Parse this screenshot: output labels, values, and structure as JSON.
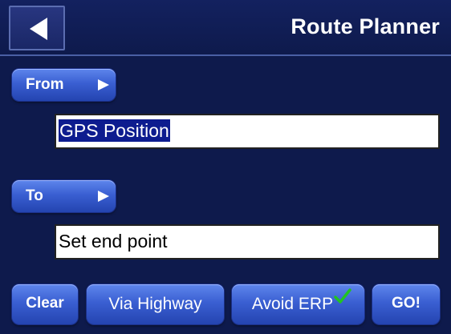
{
  "header": {
    "title": "Route Planner",
    "back_icon": "back-arrow-icon"
  },
  "from": {
    "button_label": "From",
    "field_value": "GPS Position",
    "field_selected": true
  },
  "to": {
    "button_label": "To",
    "field_value": "Set end point"
  },
  "bottom_bar": {
    "clear_label": "Clear",
    "via_highway_label": "Via Highway",
    "avoid_erp_label": "Avoid ERP",
    "avoid_erp_checked": true,
    "go_label": "GO!"
  },
  "colors": {
    "background": "#0e1a4c",
    "button": "#3a5fd2",
    "selection": "#0d1c8f",
    "check": "#22c322"
  }
}
